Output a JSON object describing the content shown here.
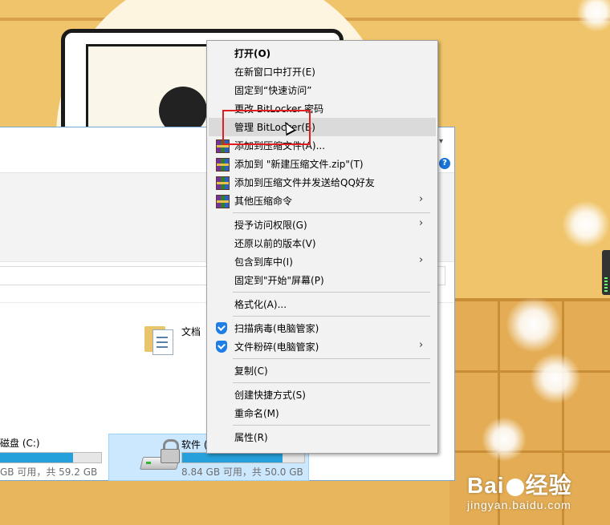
{
  "explorer": {
    "folder_label": "文档",
    "drive_c": {
      "label": "磁盘 (C:)",
      "free_text": "GB 可用，共 59.2 GB",
      "used_fraction": 0.72
    },
    "drive_d": {
      "label": "软件 (",
      "free_text": "8.84 GB 可用，共 50.0 GB",
      "used_fraction": 0.82
    },
    "help_glyph": "?"
  },
  "context_menu": {
    "items": [
      {
        "label": "打开(O)",
        "bold": true,
        "icon": "",
        "submenu": false
      },
      {
        "label": "在新窗口中打开(E)",
        "icon": "",
        "submenu": false
      },
      {
        "label": "固定到“快速访问”",
        "icon": "",
        "submenu": false
      },
      {
        "label": "更改 BitLocker 密码",
        "icon": "",
        "submenu": false
      },
      {
        "label": "管理 BitLocker(B)",
        "icon": "",
        "submenu": false,
        "hover": true
      },
      {
        "label": "添加到压缩文件(A)...",
        "icon": "winrar-icon",
        "submenu": false
      },
      {
        "label": "添加到 \"新建压缩文件.zip\"(T)",
        "icon": "winrar-icon",
        "submenu": false
      },
      {
        "label": "添加到压缩文件并发送给QQ好友",
        "icon": "winrar-icon",
        "submenu": false
      },
      {
        "label": "其他压缩命令",
        "icon": "winrar-icon",
        "submenu": true
      },
      {
        "label": "授予访问权限(G)",
        "icon": "",
        "submenu": true
      },
      {
        "label": "还原以前的版本(V)",
        "icon": "",
        "submenu": false
      },
      {
        "label": "包含到库中(I)",
        "icon": "",
        "submenu": true
      },
      {
        "label": "固定到\"开始\"屏幕(P)",
        "icon": "",
        "submenu": false
      },
      {
        "label": "格式化(A)...",
        "icon": "",
        "submenu": false
      },
      {
        "label": "扫描病毒(电脑管家)",
        "icon": "shield-icon",
        "submenu": false
      },
      {
        "label": "文件粉碎(电脑管家)",
        "icon": "shield-icon",
        "submenu": true
      },
      {
        "label": "复制(C)",
        "icon": "",
        "submenu": false
      },
      {
        "label": "创建快捷方式(S)",
        "icon": "",
        "submenu": false
      },
      {
        "label": "重命名(M)",
        "icon": "",
        "submenu": false
      },
      {
        "label": "属性(R)",
        "icon": "",
        "submenu": false
      }
    ],
    "submenu_arrow": "›"
  },
  "watermark": {
    "logo_left": "Bai",
    "logo_right": "经验",
    "url": "jingyan.baidu.com"
  },
  "colors": {
    "accent": "#26a0da",
    "highlight_box": "#e02020",
    "menu_bg": "#f2f2f2"
  }
}
